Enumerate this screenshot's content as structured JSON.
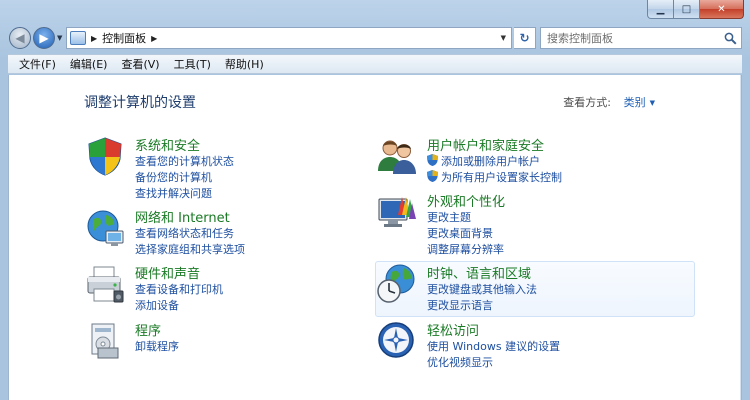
{
  "window": {
    "min_glyph": "▁",
    "max_glyph": "□",
    "close_glyph": "✕"
  },
  "nav": {
    "back_glyph": "◀",
    "forward_glyph": "▶",
    "address_path": "控制面板",
    "refresh_glyph": "↻"
  },
  "search": {
    "placeholder": "搜索控制面板"
  },
  "menu": [
    "文件(F)",
    "编辑(E)",
    "查看(V)",
    "工具(T)",
    "帮助(H)"
  ],
  "page": {
    "title": "调整计算机的设置",
    "view_by_label": "查看方式:",
    "view_by_value": "类别"
  },
  "categories": {
    "system": {
      "title": "系统和安全",
      "links": [
        "查看您的计算机状态",
        "备份您的计算机",
        "查找并解决问题"
      ]
    },
    "network": {
      "title": "网络和 Internet",
      "links": [
        "查看网络状态和任务",
        "选择家庭组和共享选项"
      ]
    },
    "hardware": {
      "title": "硬件和声音",
      "links": [
        "查看设备和打印机",
        "添加设备"
      ]
    },
    "programs": {
      "title": "程序",
      "links": [
        "卸载程序"
      ]
    },
    "users": {
      "title": "用户帐户和家庭安全",
      "links": [
        "添加或删除用户帐户",
        "为所有用户设置家长控制"
      ]
    },
    "appearance": {
      "title": "外观和个性化",
      "links": [
        "更改主题",
        "更改桌面背景",
        "调整屏幕分辨率"
      ]
    },
    "clock": {
      "title": "时钟、语言和区域",
      "links": [
        "更改键盘或其他输入法",
        "更改显示语言"
      ]
    },
    "ease": {
      "title": "轻松访问",
      "links": [
        "使用 Windows 建议的设置",
        "优化视频显示"
      ]
    }
  },
  "colors": {
    "category_title": "#1a7a25",
    "link": "#1e4fa0",
    "page_title": "#1e3d6d"
  }
}
